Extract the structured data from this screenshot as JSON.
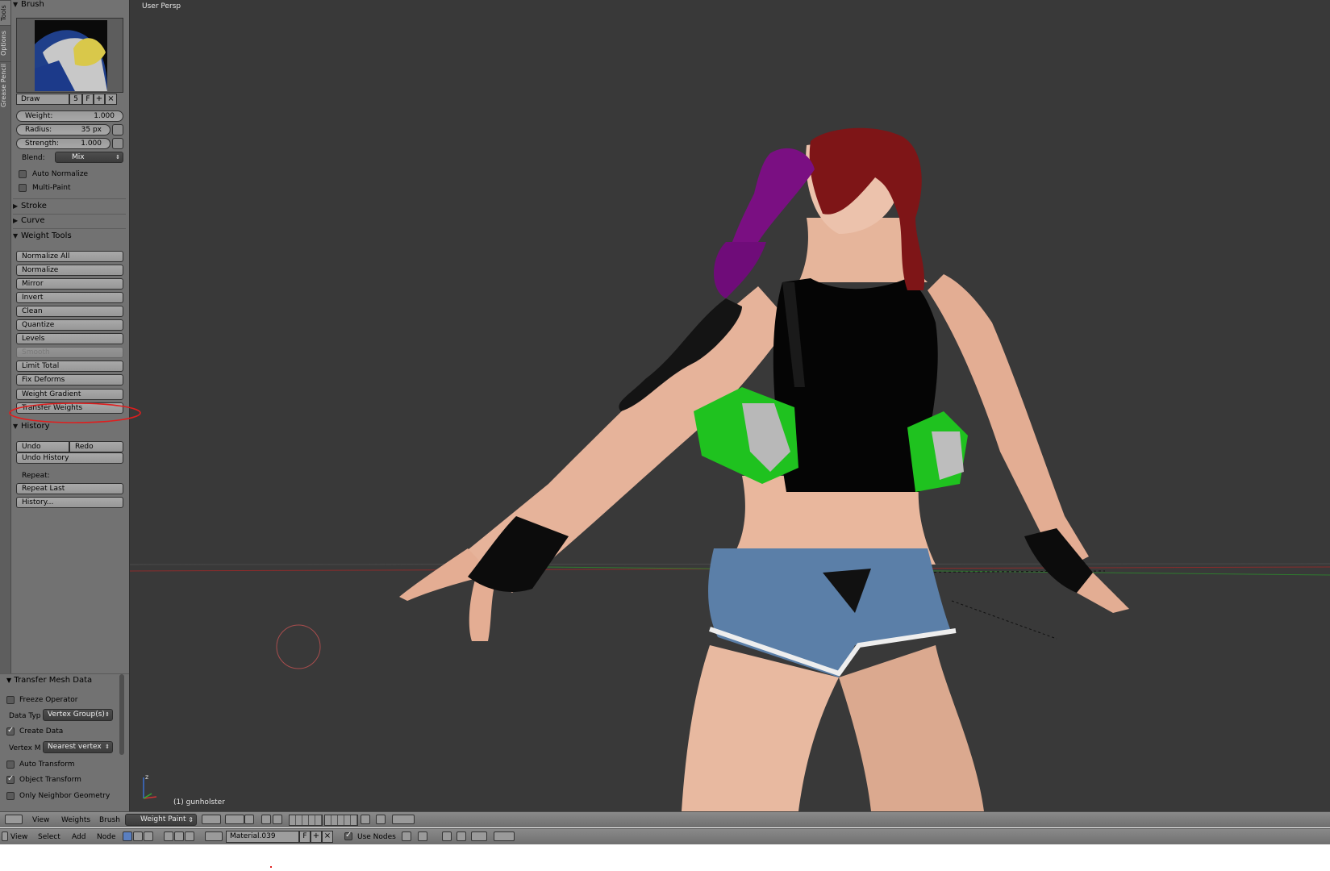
{
  "viewport": {
    "label": "User Persp",
    "object_name": "(1) gunholster"
  },
  "vertical_tabs": [
    "Tools",
    "Options",
    "Grease Pencil"
  ],
  "brush": {
    "panel_title": "Brush",
    "name": "Draw",
    "users": "5",
    "fake_user": "F",
    "weight": {
      "label": "Weight:",
      "value": "1.000"
    },
    "radius": {
      "label": "Radius:",
      "value": "35 px"
    },
    "strength": {
      "label": "Strength:",
      "value": "1.000"
    },
    "blend": {
      "label": "Blend:",
      "value": "Mix"
    },
    "auto_normalize": {
      "label": "Auto Normalize",
      "checked": false
    },
    "multi_paint": {
      "label": "Multi-Paint",
      "checked": false
    }
  },
  "panels": {
    "stroke": "Stroke",
    "curve": "Curve",
    "weight_tools": "Weight Tools",
    "history": "History"
  },
  "weight_tools": [
    {
      "label": "Normalize All",
      "enabled": true
    },
    {
      "label": "Normalize",
      "enabled": true
    },
    {
      "label": "Mirror",
      "enabled": true
    },
    {
      "label": "Invert",
      "enabled": true
    },
    {
      "label": "Clean",
      "enabled": true
    },
    {
      "label": "Quantize",
      "enabled": true
    },
    {
      "label": "Levels",
      "enabled": true
    },
    {
      "label": "Smooth",
      "enabled": false
    },
    {
      "label": "Limit Total",
      "enabled": true
    },
    {
      "label": "Fix Deforms",
      "enabled": true
    },
    {
      "label": "Weight Gradient",
      "enabled": true
    },
    {
      "label": "Transfer Weights",
      "enabled": true,
      "highlighted": true
    }
  ],
  "history": {
    "undo": "Undo",
    "redo": "Redo",
    "undo_history": "Undo History",
    "repeat_label": "Repeat:",
    "repeat_last": "Repeat Last",
    "history_menu": "History..."
  },
  "operator_panel": {
    "title": "Transfer Mesh Data",
    "freeze_operator": {
      "label": "Freeze Operator",
      "checked": false
    },
    "data_type": {
      "label": "Data Typ",
      "value": "Vertex Group(s)"
    },
    "create_data": {
      "label": "Create Data",
      "checked": true
    },
    "vertex_mapping": {
      "label": "Vertex M",
      "value": "Nearest vertex"
    },
    "auto_transform": {
      "label": "Auto Transform",
      "checked": false
    },
    "object_transform": {
      "label": "Object Transform",
      "checked": true
    },
    "only_neighbor": {
      "label": "Only Neighbor Geometry",
      "checked": false
    }
  },
  "view3d_header": {
    "menus": [
      "View",
      "Weights",
      "Brush"
    ],
    "mode": "Weight Paint"
  },
  "node_header": {
    "menus": [
      "View",
      "Select",
      "Add",
      "Node"
    ],
    "material": "Material.039",
    "fake_user": "F",
    "use_nodes": {
      "label": "Use Nodes",
      "checked": true
    }
  },
  "colors": {
    "highlight": "#e01e1e",
    "viewport_bg": "#393939",
    "panel_bg": "#727272",
    "hair": "#7a0f82",
    "top": "#050505",
    "holster": "#1fc21f",
    "shorts": "#5b7fa8"
  }
}
